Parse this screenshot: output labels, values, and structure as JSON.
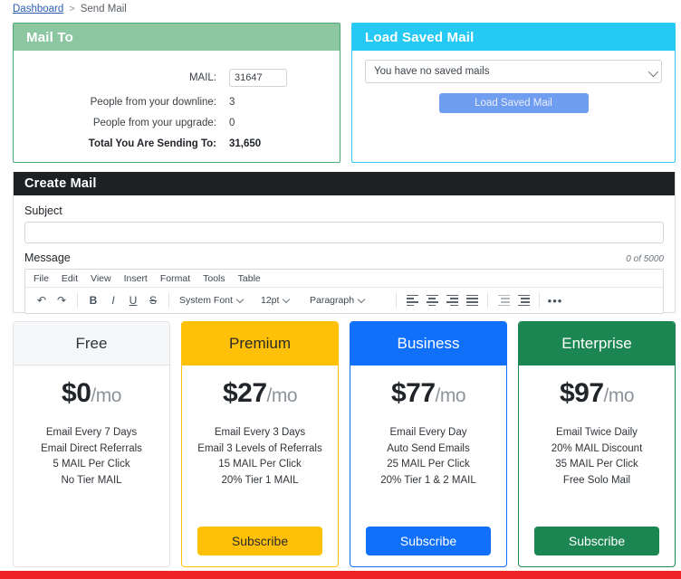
{
  "breadcrumb": {
    "root": "Dashboard",
    "separator": ">",
    "current": "Send Mail"
  },
  "mail_to": {
    "title": "Mail To",
    "mail_label": "MAIL:",
    "mail_value": "31647",
    "rows": [
      {
        "label": "People from your downline:",
        "value": "3"
      },
      {
        "label": "People from your upgrade:",
        "value": "0"
      },
      {
        "label": "Total You Are Sending To:",
        "value": "31,650"
      }
    ]
  },
  "load_saved": {
    "title": "Load Saved Mail",
    "select_value": "You have no saved mails",
    "button_label": "Load Saved Mail"
  },
  "create_mail": {
    "title": "Create Mail",
    "subject_label": "Subject",
    "subject_value": "",
    "subject_placeholder": "",
    "message_label": "Message",
    "counter": "0 of 5000",
    "menu": [
      "File",
      "Edit",
      "View",
      "Insert",
      "Format",
      "Tools",
      "Table"
    ],
    "toolbar": {
      "undo": "↶",
      "redo": "↷",
      "bold": "B",
      "italic": "I",
      "underline": "U",
      "strike": "S",
      "font_family": "System Font",
      "font_size": "12pt",
      "block_format": "Paragraph",
      "align_left": "align-left",
      "align_center": "align-center",
      "align_right": "align-right",
      "align_justify": "align-justify",
      "outdent": "outdent",
      "indent": "indent",
      "more": "•••"
    }
  },
  "pricing": {
    "plans": [
      {
        "name": "Free",
        "amount": "$0",
        "period": "/mo",
        "features": [
          "Email Every 7 Days",
          "Email Direct Referrals",
          "5 MAIL Per Click",
          "No Tier MAIL"
        ],
        "button_label": "",
        "accent": "#f6f7f8"
      },
      {
        "name": "Premium",
        "amount": "$27",
        "period": "/mo",
        "features": [
          "Email Every 3 Days",
          "Email 3 Levels of Referrals",
          "15 MAIL Per Click",
          "20% Tier 1 MAIL"
        ],
        "button_label": "Subscribe",
        "accent": "#ffc107"
      },
      {
        "name": "Business",
        "amount": "$77",
        "period": "/mo",
        "features": [
          "Email Every Day",
          "Auto Send Emails",
          "25 MAIL Per Click",
          "20% Tier 1 & 2 MAIL"
        ],
        "button_label": "Subscribe",
        "accent": "#1070fa"
      },
      {
        "name": "Enterprise",
        "amount": "$97",
        "period": "/mo",
        "features": [
          "Email Twice Daily",
          "20% MAIL Discount",
          "35 MAIL Per Click",
          "Free Solo Mail"
        ],
        "button_label": "Subscribe",
        "accent": "#1c8653"
      }
    ]
  },
  "colors": {
    "mail_to_header": "#8cc7a1",
    "load_saved_header": "#25c9f3",
    "create_mail_header": "#1d2124",
    "load_button": "#6f9ef0",
    "bottom_bar": "#ee2324"
  }
}
